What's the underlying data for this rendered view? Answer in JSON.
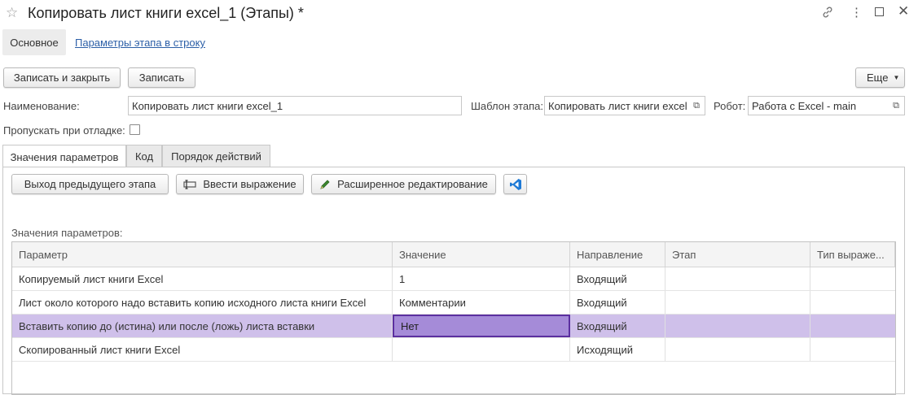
{
  "window": {
    "title": "Копировать лист книги excel_1 (Этапы) *"
  },
  "nav_tabs": {
    "main": "Основное",
    "link": "Параметры этапа в строку"
  },
  "toolbar": {
    "save_close": "Записать и закрыть",
    "save": "Записать",
    "more": "Еще"
  },
  "form": {
    "name_label": "Наименование:",
    "name_value": "Копировать лист книги excel_1",
    "template_label": "Шаблон этапа:",
    "template_value": "Копировать лист книги excel",
    "robot_label": "Робот:",
    "robot_value": "Работа с Excel - main",
    "skip_label": "Пропускать при отладке:",
    "skip_checked": false
  },
  "tabs": [
    "Значения параметров",
    "Код",
    "Порядок действий"
  ],
  "param_toolbar": {
    "prev_output": "Выход предыдущего этапа",
    "enter_expr": "Ввести выражение",
    "advanced_edit": "Расширенное редактирование"
  },
  "params_section_label": "Значения параметров:",
  "table": {
    "columns": [
      "Параметр",
      "Значение",
      "Направление",
      "Этап",
      "Тип выраже..."
    ],
    "rows": [
      [
        "Копируемый лист книги Excel",
        "1",
        "Входящий",
        "",
        ""
      ],
      [
        "Лист около которого надо вставить копию исходного листа книги Excel",
        "Комментарии",
        "Входящий",
        "",
        ""
      ],
      [
        "Вставить копию до (истина) или после (ложь) листа вставки",
        "Нет",
        "Входящий",
        "",
        ""
      ],
      [
        "Скопированный лист книги Excel",
        "",
        "Исходящий",
        "",
        ""
      ]
    ],
    "selected_row": 2
  },
  "colors": {
    "link": "#2c5fa7",
    "selection": "#cfc0ea",
    "focus_cell": "#a58bd8",
    "focus_border": "#5b2fa0"
  }
}
